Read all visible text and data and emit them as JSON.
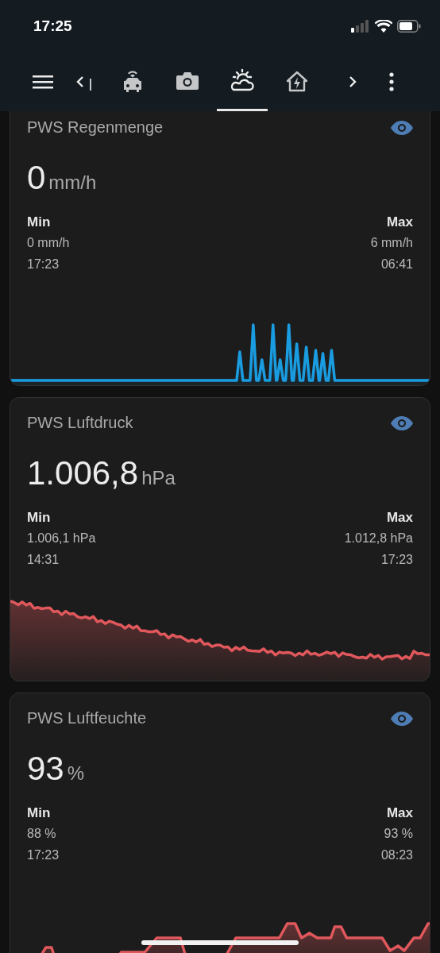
{
  "status_bar": {
    "time": "17:25"
  },
  "tabs": [
    {
      "selected": false
    },
    {
      "selected": false
    },
    {
      "selected": true
    },
    {
      "selected": false
    }
  ],
  "cards": [
    {
      "title": "PWS Regenmenge",
      "value": "0",
      "unit": "mm/h",
      "min_label": "Min",
      "min_value": "0 mm/h",
      "min_time": "17:23",
      "max_label": "Max",
      "max_value": "6 mm/h",
      "max_time": "06:41",
      "color": "#1a9ce0"
    },
    {
      "title": "PWS Luftdruck",
      "value": "1.006,8",
      "unit": "hPa",
      "min_label": "Min",
      "min_value": "1.006,1 hPa",
      "min_time": "14:31",
      "max_label": "Max",
      "max_value": "1.012,8 hPa",
      "max_time": "17:23",
      "color": "#e0585c"
    },
    {
      "title": "PWS Luftfeuchte",
      "value": "93",
      "unit": "%",
      "min_label": "Min",
      "min_value": "88 %",
      "min_time": "17:23",
      "max_label": "Max",
      "max_value": "93 %",
      "max_time": "08:23",
      "color": "#e0585c"
    }
  ]
}
